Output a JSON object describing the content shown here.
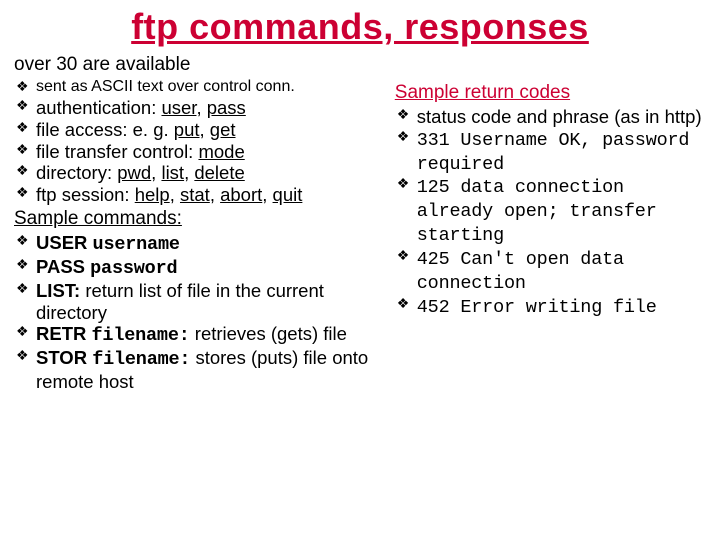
{
  "title": "ftp commands, responses",
  "subtitle": "over 30 are available",
  "left": {
    "items": [
      {
        "html": "sent as ASCII text over control conn.",
        "small": true
      },
      {
        "html": "authentication: <span class='u'>user</span>, <span class='u'>pass</span>"
      },
      {
        "html": "file access: e. g. <span class='u'>put</span>, <span class='u'>get</span>"
      },
      {
        "html": "file transfer control: <span class='u'>mode</span>"
      },
      {
        "html": "directory: <span class='u'>pwd</span>, <span class='u'>list</span>, <span class='u'>delete</span>"
      },
      {
        "html": "ftp session: <span class='u'>help</span>, <span class='u'>stat</span>, <span class='u'>abort</span>, <span class='u'>quit</span>"
      }
    ],
    "section": "Sample commands:",
    "commands": [
      {
        "html": "<span class='b'>USER</span> <span class='b mono'>username</span>"
      },
      {
        "html": "<span class='b'>PASS</span> <span class='b mono'>password</span>"
      },
      {
        "html": "<span class='b'>LIST:</span> return list of file in the current directory"
      },
      {
        "html": "<span class='b'>RETR</span> <span class='b mono'>filename:</span> retrieves (gets) file"
      },
      {
        "html": "<span class='b'>STOR</span> <span class='b mono'>filename:</span> stores (puts) file onto remote host"
      }
    ]
  },
  "right": {
    "section": "Sample return codes",
    "items": [
      {
        "html": "status code and phrase (as in http)"
      },
      {
        "html": "<span class='mono'>331 Username OK, password required</span>"
      },
      {
        "html": "<span class='mono'>125 data connection already open; transfer starting</span>"
      },
      {
        "html": "<span class='mono'>425 Can't open data connection</span>"
      },
      {
        "html": "<span class='mono'>452 Error writing file</span>"
      }
    ]
  }
}
